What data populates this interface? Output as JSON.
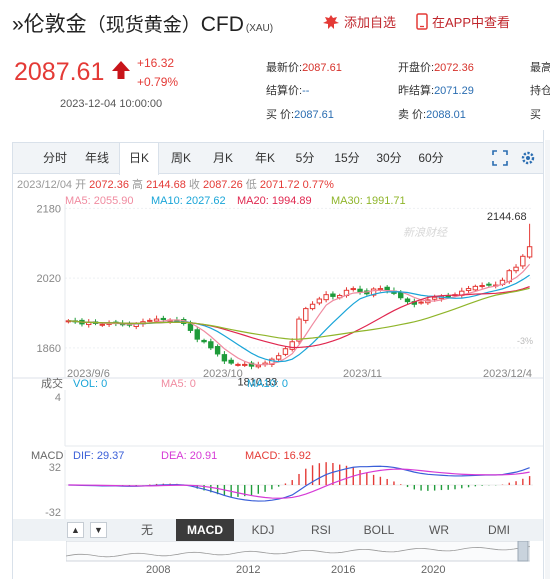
{
  "header": {
    "title_prefix": "»伦敦金",
    "title_paren": "（现货黄金）",
    "title_cfd": "CFD",
    "title_sub": "(XAU)",
    "add_watch": "添加自选",
    "open_app": "在APP中查看"
  },
  "quote": {
    "price": "2087.61",
    "change": "+16.32",
    "change_pct": "+0.79%",
    "time": "2023-12-04 10:00:00",
    "stats": [
      {
        "label": "最新价:",
        "value": "2087.61"
      },
      {
        "label": "开盘价:",
        "value": "2072.36"
      },
      {
        "label": "最高",
        "value": ""
      },
      {
        "label": "结算价:",
        "value": "--"
      },
      {
        "label": "昨结算:",
        "value": "2071.29"
      },
      {
        "label": "持仓",
        "value": ""
      },
      {
        "label": "买  价:",
        "value": "2087.61"
      },
      {
        "label": "卖  价:",
        "value": "2088.01"
      },
      {
        "label": "买",
        "value": ""
      }
    ]
  },
  "tabs": [
    "分时",
    "年线",
    "日K",
    "周K",
    "月K",
    "年K",
    "5分",
    "15分",
    "30分",
    "60分"
  ],
  "active_tab": "日K",
  "info_line": {
    "date": "2023/12/04",
    "open_l": "开",
    "open": "2072.36",
    "high_l": "高",
    "high": "2144.68",
    "close_l": "收",
    "close": "2087.26",
    "low_l": "低",
    "low": "2071.72",
    "pct": "0.77%"
  },
  "ma_line": {
    "ma5": "MA5: 2055.90",
    "ma10": "MA10: 2027.62",
    "ma20": "MA20: 1994.89",
    "ma30": "MA30: 1991.71"
  },
  "price_axis": [
    "2180",
    "2020",
    "1860"
  ],
  "x_labels": [
    "2023/9/6",
    "2023/10",
    "2023/11",
    "2023/12/4"
  ],
  "annot": {
    "max": "2144.68",
    "min": "1810.33",
    "pct": "-3%",
    "watermark": "新浪财经"
  },
  "volume": {
    "label": "成交",
    "vol": "VOL: 0",
    "ma5": "MA5: 0",
    "ma10": "MA10: 0",
    "axis": "4"
  },
  "macd": {
    "label": "MACD",
    "dif": "DIF: 29.37",
    "dea": "DEA: 20.91",
    "macd": "MACD: 16.92",
    "axis_top": "32",
    "axis_bot": "-32"
  },
  "indicators": [
    "无",
    "MACD",
    "KDJ",
    "RSI",
    "BOLL",
    "WR",
    "DMI"
  ],
  "active_indicator": "MACD",
  "timeline": [
    "2008",
    "2012",
    "2016",
    "2020"
  ],
  "colors": {
    "up": "#e43a36",
    "down": "#1f9b3a",
    "ma5": "#f08ba0",
    "ma10": "#1aa5d8",
    "ma20": "#e0274f",
    "ma30": "#8fb52a",
    "dif": "#3a5fd8",
    "dea": "#d63ad6"
  },
  "chart_data": {
    "type": "candlestick",
    "x_range": [
      "2023/9/6",
      "2023/12/4"
    ],
    "ylim": [
      1800,
      2190
    ],
    "annotated_high": 2144.68,
    "annotated_low": 1810.33,
    "ohlc_close_approx": [
      1922,
      1920,
      1915,
      1918,
      1916,
      1914,
      1916,
      1917,
      1913,
      1912,
      1915,
      1920,
      1923,
      1926,
      1925,
      1924,
      1922,
      1916,
      1900,
      1880,
      1874,
      1860,
      1846,
      1830,
      1825,
      1822,
      1822,
      1818,
      1820,
      1825,
      1834,
      1842,
      1858,
      1874,
      1926,
      1950,
      1960,
      1972,
      1982,
      1978,
      1980,
      1992,
      1996,
      1989,
      1984,
      1995,
      1996,
      1992,
      1985,
      1975,
      1966,
      1960,
      1965,
      1970,
      1976,
      1979,
      1978,
      1982,
      1990,
      1996,
      2001,
      2003,
      2005,
      2004,
      2015,
      2037,
      2045,
      2070,
      2092
    ]
  }
}
